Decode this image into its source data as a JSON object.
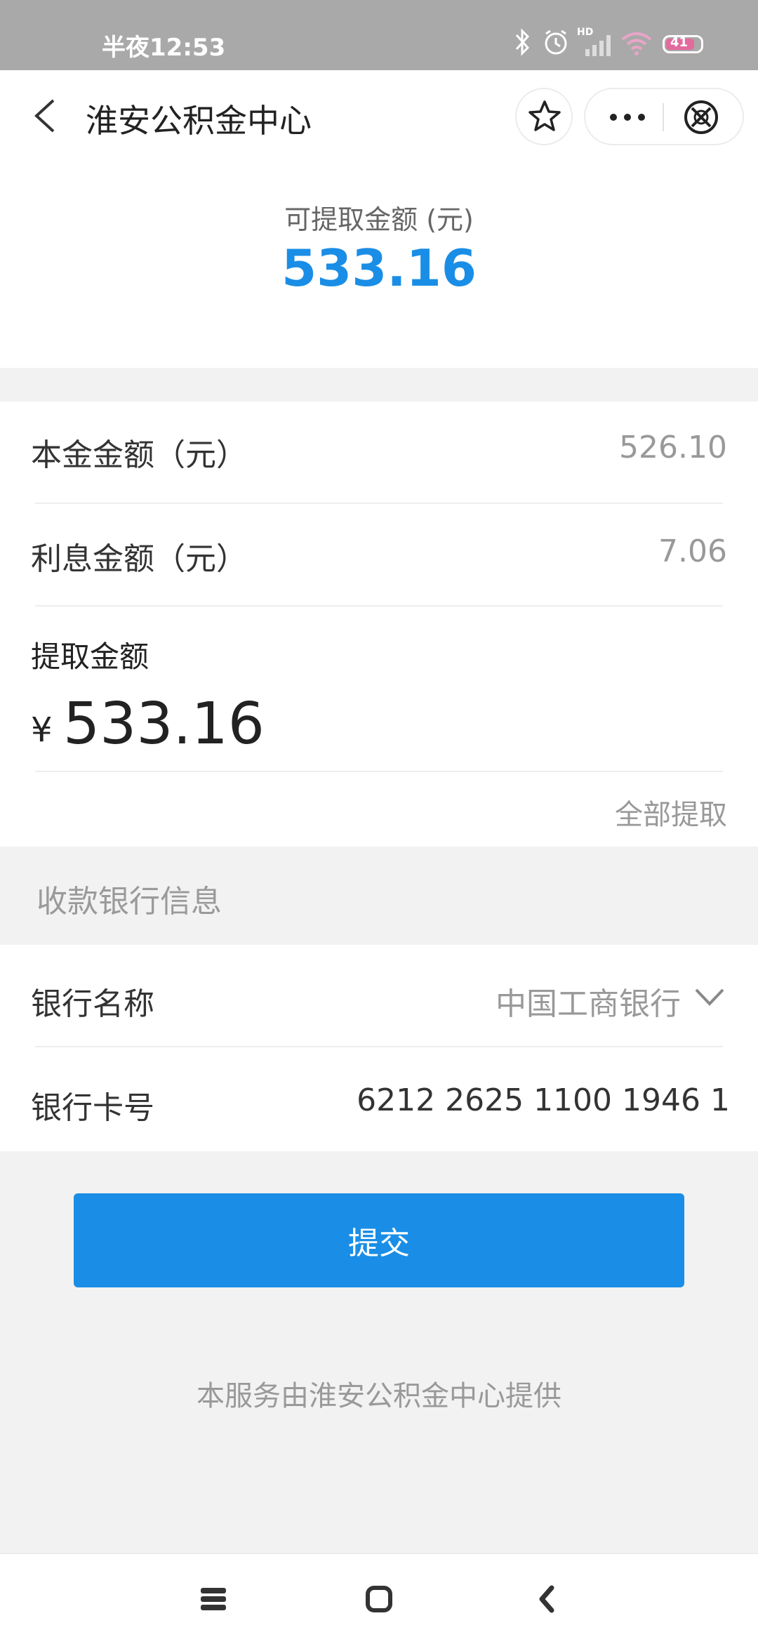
{
  "status_bar": {
    "time": "半夜12:53",
    "network_label": "HD",
    "battery_level": "41",
    "icons": [
      "bluetooth-icon",
      "alarm-icon",
      "signal-icon",
      "wifi-icon",
      "battery-icon"
    ]
  },
  "nav": {
    "title": "淮安公积金中心",
    "icons": [
      "back-icon",
      "star-icon",
      "more-icon",
      "close-icon"
    ]
  },
  "summary": {
    "label": "可提取金额 (元)",
    "amount": "533.16",
    "amount_color": "#1a8ee6"
  },
  "details": {
    "principal_label": "本金金额（元）",
    "principal_value": "526.10",
    "interest_label": "利息金额（元）",
    "interest_value": "7.06",
    "withdraw_label": "提取金额",
    "currency_symbol": "¥",
    "withdraw_amount": "533.16",
    "withdraw_all_label": "全部提取"
  },
  "bank": {
    "section_title": "收款银行信息",
    "name_label": "银行名称",
    "name_value": "中国工商银行",
    "card_label": "银行卡号",
    "card_value": "6212 2625 1100 1946 1"
  },
  "actions": {
    "submit_label": "提交",
    "submit_color": "#1a8ee6"
  },
  "footer": {
    "text": "本服务由淮安公积金中心提供"
  },
  "system_nav": {
    "icons": [
      "menu-icon",
      "home-icon",
      "back-nav-icon"
    ]
  }
}
